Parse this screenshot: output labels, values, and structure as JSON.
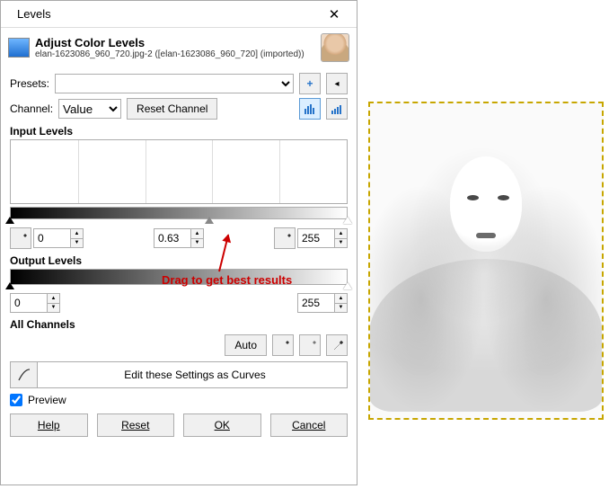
{
  "titlebar": {
    "title": "Levels",
    "close_glyph": "✕"
  },
  "header": {
    "title": "Adjust Color Levels",
    "subtitle": "elan-1623086_960_720.jpg-2 ([elan-1623086_960_720] (imported))"
  },
  "presets": {
    "label": "Presets:",
    "value": "",
    "plus": "+",
    "menu": "◂"
  },
  "channel": {
    "label": "Channel:",
    "value": "Value",
    "reset_label": "Reset Channel"
  },
  "input_levels": {
    "title": "Input Levels",
    "black": "0",
    "gamma": "0.63",
    "white": "255",
    "gamma_pos_pct": 59
  },
  "output_levels": {
    "title": "Output Levels",
    "low": "0",
    "high": "255"
  },
  "all_channels": {
    "title": "All Channels",
    "auto_label": "Auto"
  },
  "curves_btn": "Edit these Settings as Curves",
  "preview": {
    "label": "Preview",
    "checked": true
  },
  "buttons": {
    "help": "Help",
    "reset": "Reset",
    "ok": "OK",
    "cancel": "Cancel"
  },
  "annotation": "Drag to get best results"
}
